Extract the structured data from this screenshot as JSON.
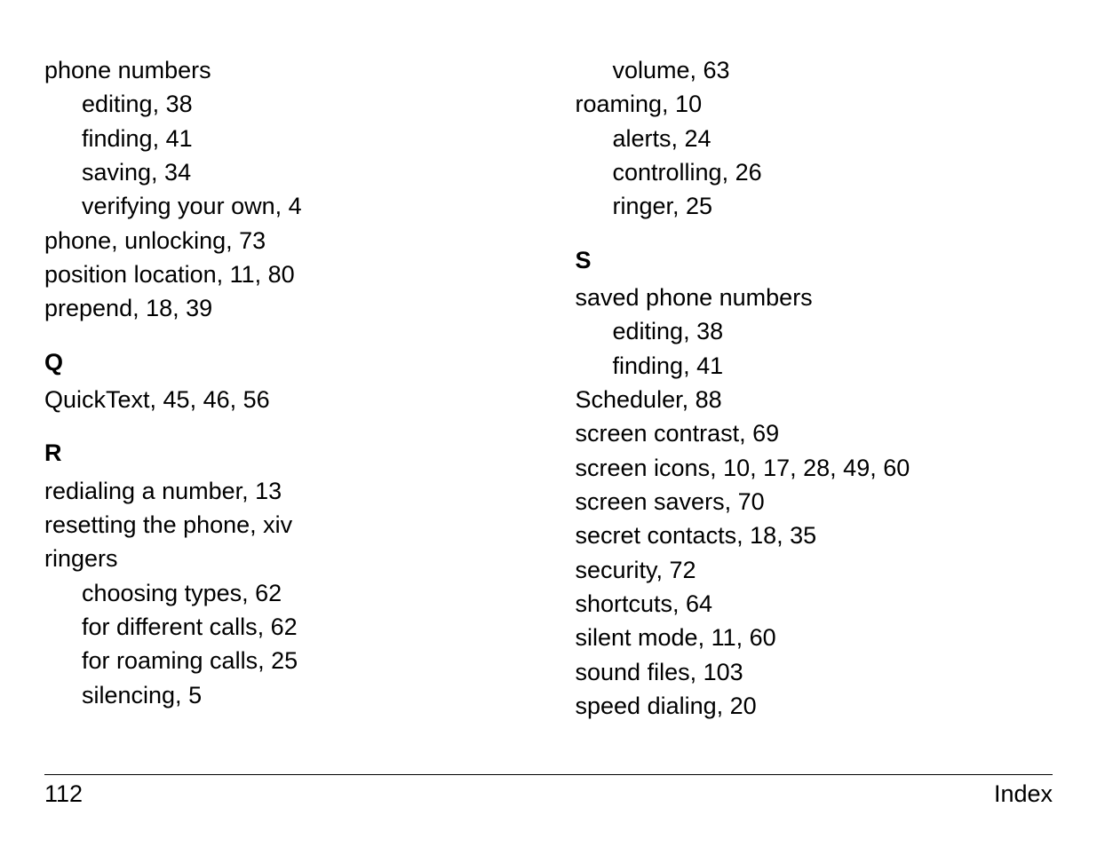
{
  "left": {
    "entries_top": [
      "phone numbers",
      [
        "editing, 38",
        true
      ],
      [
        "finding, 41",
        true
      ],
      [
        "saving, 34",
        true
      ],
      [
        "verifying your own, 4",
        true
      ],
      "phone, unlocking, 73",
      "position location, 11, 80",
      "prepend, 18, 39"
    ],
    "section_q": "Q",
    "entries_q": [
      "QuickText, 45, 46, 56"
    ],
    "section_r": "R",
    "entries_r": [
      "redialing a number, 13",
      "resetting the phone, xiv",
      "ringers",
      [
        "choosing types, 62",
        true
      ],
      [
        "for different calls, 62",
        true
      ],
      [
        "for roaming calls, 25",
        true
      ],
      [
        "silencing, 5",
        true
      ]
    ]
  },
  "right": {
    "entries_top": [
      [
        "volume, 63",
        true
      ],
      "roaming, 10",
      [
        "alerts, 24",
        true
      ],
      [
        "controlling, 26",
        true
      ],
      [
        "ringer, 25",
        true
      ]
    ],
    "section_s": "S",
    "entries_s": [
      "saved phone numbers",
      [
        "editing, 38",
        true
      ],
      [
        "finding, 41",
        true
      ],
      "Scheduler, 88",
      "screen contrast, 69",
      "screen icons, 10, 17, 28, 49, 60",
      "screen savers, 70",
      "secret contacts, 18, 35",
      "security, 72",
      "shortcuts, 64",
      "silent mode, 11, 60",
      "sound files, 103",
      "speed dialing, 20"
    ]
  },
  "footer": {
    "page_number": "112",
    "label": "Index"
  }
}
